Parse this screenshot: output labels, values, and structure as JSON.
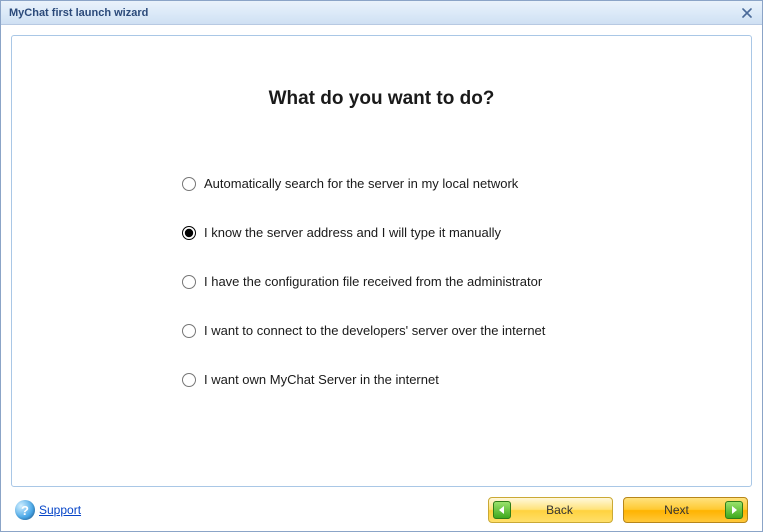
{
  "window": {
    "title": "MyChat first launch wizard"
  },
  "heading": "What do you want to do?",
  "selected_option": 1,
  "options": [
    {
      "label": "Automatically search for the server in my local network"
    },
    {
      "label": "I know the server address and I will type it manually"
    },
    {
      "label": "I have the configuration file received from the administrator"
    },
    {
      "label": "I want to connect to the developers' server over the internet"
    },
    {
      "label": "I want own MyChat Server in the internet"
    }
  ],
  "footer": {
    "support_label": "Support",
    "back_label": "Back",
    "next_label": "Next"
  }
}
